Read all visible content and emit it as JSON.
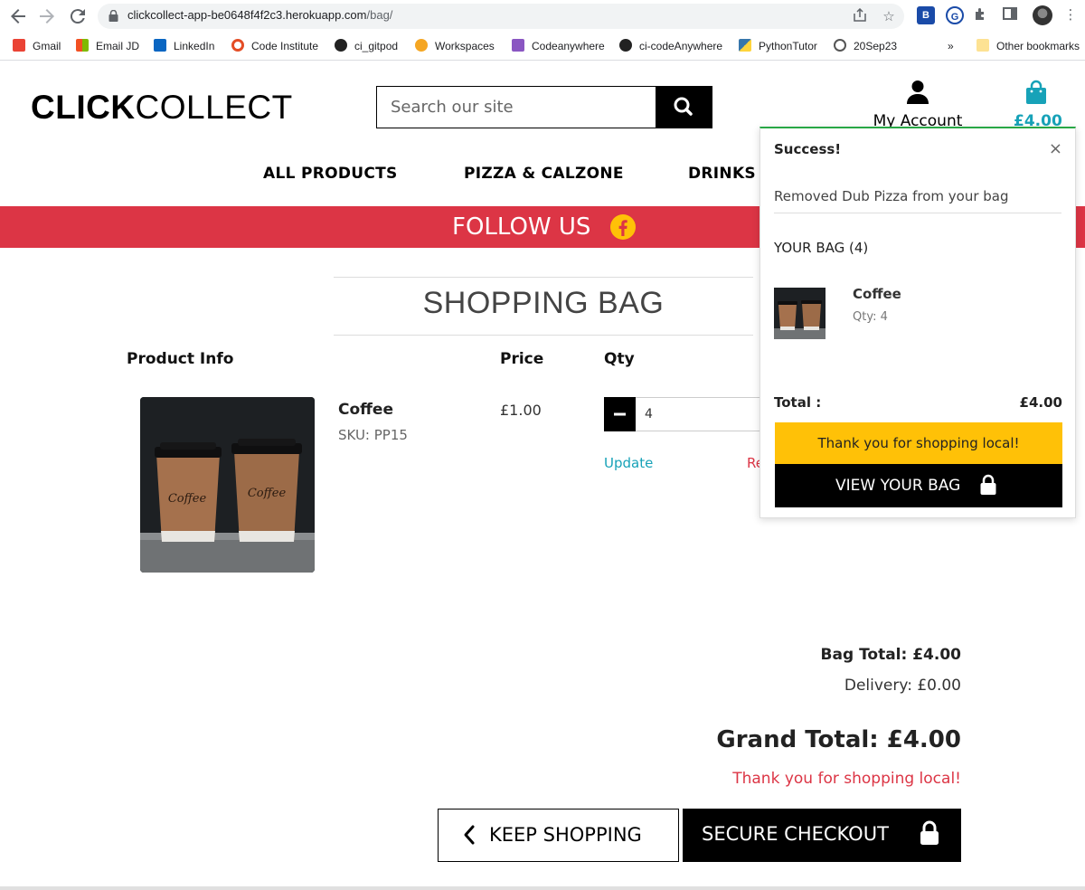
{
  "browser": {
    "url_main": "clickcollect-app-be0648f4f2c3.herokuapp.com",
    "url_path": "/bag/",
    "bookmarks": [
      {
        "label": "Gmail",
        "color": "#ea4335"
      },
      {
        "label": "Email JD",
        "color": "#00a4ef"
      },
      {
        "label": "LinkedIn",
        "color": "#0a66c2"
      },
      {
        "label": "Code Institute",
        "color": "#e44d26"
      },
      {
        "label": "ci_gitpod",
        "color": "#222222"
      },
      {
        "label": "Workspaces",
        "color": "#f5a623"
      },
      {
        "label": "Codeanywhere",
        "color": "#8a56c2"
      },
      {
        "label": "ci-codeAnywhere",
        "color": "#222222"
      },
      {
        "label": "PythonTutor",
        "color": "#3776ab"
      },
      {
        "label": "20Sep23",
        "color": "#555555"
      }
    ],
    "overflow": "»",
    "other_bookmarks": "Other bookmarks"
  },
  "header": {
    "logo_bold": "CLICK",
    "logo_light": "COLLECT",
    "search_placeholder": "Search our site",
    "account_label": "My Account",
    "bag_amount": "£4.00"
  },
  "nav": {
    "items": [
      "ALL PRODUCTS",
      "PIZZA & CALZONE",
      "DRINKS"
    ]
  },
  "banner": {
    "text": "FOLLOW US"
  },
  "bag": {
    "title": "SHOPPING BAG",
    "columns": [
      "Product Info",
      "Price",
      "Qty"
    ],
    "item": {
      "name": "Coffee",
      "sku": "SKU: PP15",
      "price": "£1.00",
      "qty": "4",
      "update_label": "Update",
      "remove_label": "Re"
    },
    "bag_total": "Bag Total: £4.00",
    "delivery": "Delivery: £0.00",
    "grand_total": "Grand Total: £4.00",
    "thanks": "Thank you for shopping local!",
    "keep_shopping": "KEEP SHOPPING",
    "secure_checkout": "SECURE CHECKOUT"
  },
  "toast": {
    "heading": "Success!",
    "close": "×",
    "message": "Removed Dub Pizza from your bag",
    "bag_heading": "YOUR BAG (4)",
    "item_name": "Coffee",
    "item_qty": "Qty: 4",
    "total_label": "Total :",
    "total_value": "£4.00",
    "thanks": "Thank you for shopping local!",
    "view_bag": "VIEW YOUR BAG"
  },
  "colors": {
    "brand_red": "#dc3545",
    "accent_teal": "#17a2b8",
    "highlight_yellow": "#ffc107",
    "success_green": "#28a745"
  },
  "icons": [
    "back-icon",
    "forward-icon",
    "reload-icon",
    "lock-icon",
    "share-icon",
    "star-icon",
    "extensions-icon",
    "sidebar-icon",
    "profile-avatar",
    "menu-icon",
    "search-icon",
    "user-icon",
    "shopping-bag-icon",
    "facebook-icon",
    "chevron-left-icon",
    "padlock-icon"
  ]
}
